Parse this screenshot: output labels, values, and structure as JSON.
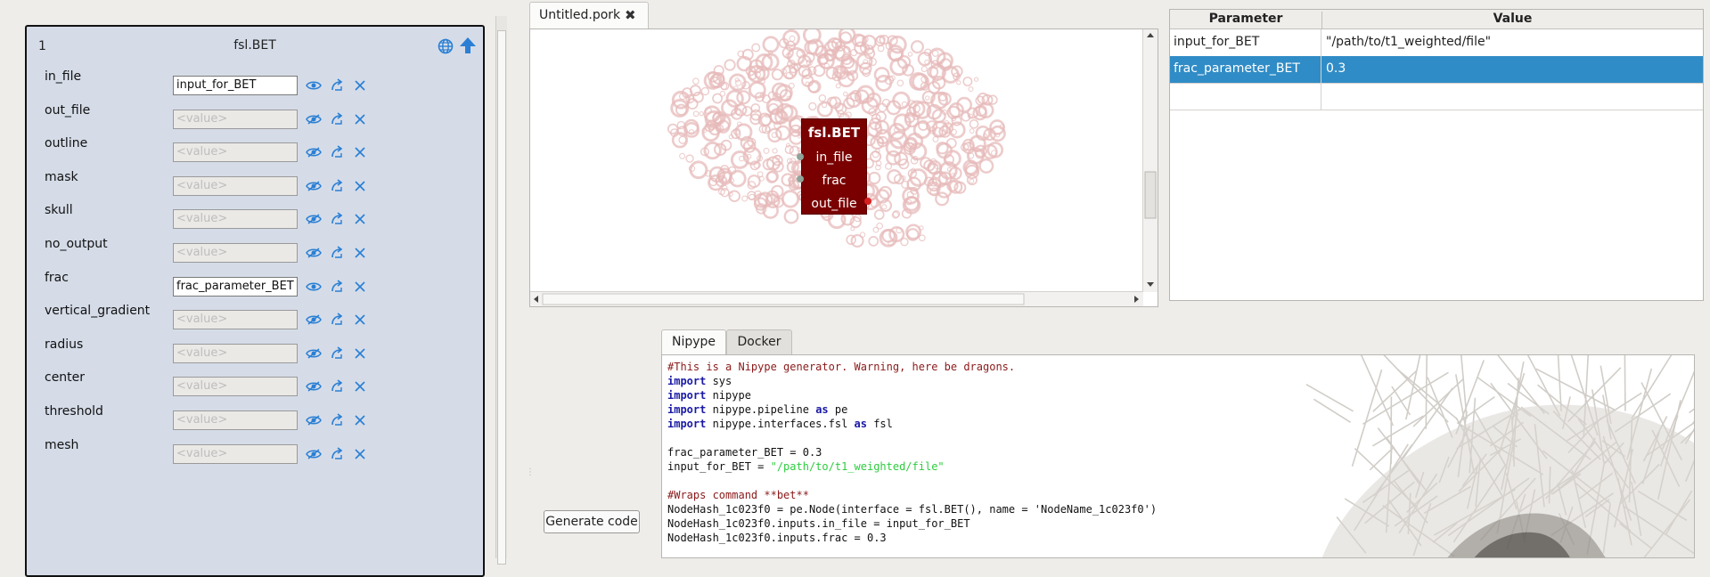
{
  "node_panel": {
    "index": "1",
    "title": "fsl.BET",
    "params": [
      {
        "label": "in_file",
        "value": "input_for_BET",
        "filled": true
      },
      {
        "label": "out_file",
        "value": "",
        "filled": false
      },
      {
        "label": "outline",
        "value": "",
        "filled": false
      },
      {
        "label": "mask",
        "value": "",
        "filled": false
      },
      {
        "label": "skull",
        "value": "",
        "filled": false
      },
      {
        "label": "no_output",
        "value": "",
        "filled": false
      },
      {
        "label": "frac",
        "value": "frac_parameter_BET",
        "filled": true
      },
      {
        "label": "vertical_gradient",
        "value": "",
        "filled": false
      },
      {
        "label": "radius",
        "value": "",
        "filled": false
      },
      {
        "label": "center",
        "value": "",
        "filled": false
      },
      {
        "label": "threshold",
        "value": "",
        "filled": false
      },
      {
        "label": "mesh",
        "value": "",
        "filled": false
      }
    ],
    "placeholder": "<value>"
  },
  "graph": {
    "tab_label": "Untitled.pork",
    "close_glyph": "✖",
    "node": {
      "title": "fsl.BET",
      "ports": [
        "in_file",
        "frac",
        "out_file"
      ]
    }
  },
  "param_table": {
    "headers": [
      "Parameter",
      "Value"
    ],
    "rows": [
      {
        "parameter": "input_for_BET",
        "value": "\"/path/to/t1_weighted/file\"",
        "selected": false
      },
      {
        "parameter": "frac_parameter_BET",
        "value": "0.3",
        "selected": true
      },
      {
        "parameter": "",
        "value": "",
        "selected": false
      }
    ]
  },
  "code_panel": {
    "generate_label": "Generate code",
    "tabs": [
      "Nipype",
      "Docker"
    ],
    "active_tab": "Nipype",
    "lines": [
      [
        [
          "cm",
          "#This is a Nipype generator. Warning, here be dragons."
        ]
      ],
      [
        [
          "kw",
          "import"
        ],
        [
          "",
          " sys"
        ]
      ],
      [
        [
          "kw",
          "import"
        ],
        [
          "",
          " nipype"
        ]
      ],
      [
        [
          "kw",
          "import"
        ],
        [
          "",
          " nipype.pipeline "
        ],
        [
          "kw",
          "as"
        ],
        [
          "",
          " pe"
        ]
      ],
      [
        [
          "kw",
          "import"
        ],
        [
          "",
          " nipype.interfaces.fsl "
        ],
        [
          "kw",
          "as"
        ],
        [
          "",
          " fsl"
        ]
      ],
      [
        [
          "",
          ""
        ]
      ],
      [
        [
          "",
          "frac_parameter_BET = 0.3"
        ]
      ],
      [
        [
          "",
          "input_for_BET = "
        ],
        [
          "st",
          "\"/path/to/t1_weighted/file\""
        ]
      ],
      [
        [
          "",
          ""
        ]
      ],
      [
        [
          "cm",
          "#Wraps command **bet**"
        ]
      ],
      [
        [
          "",
          "NodeHash_1c023f0 = pe.Node(interface = fsl.BET(), name = 'NodeName_1c023f0')"
        ]
      ],
      [
        [
          "",
          "NodeHash_1c023f0.inputs.in_file = input_for_BET"
        ]
      ],
      [
        [
          "",
          "NodeHash_1c023f0.inputs.frac = 0.3"
        ]
      ]
    ]
  },
  "colors": {
    "node_panel_bg": "#d5dce8",
    "icon_blue": "#2a7fd4",
    "graph_node": "#7a0000",
    "selection": "#308cc6",
    "code_comment": "#8b1a1a",
    "code_keyword": "#1a1aa6",
    "code_string": "#2ecc40"
  },
  "icons": [
    "globe-icon",
    "upload-arrow-icon",
    "eye-icon",
    "eye-off-icon",
    "link-icon",
    "clear-x-icon",
    "close-tab-icon"
  ]
}
